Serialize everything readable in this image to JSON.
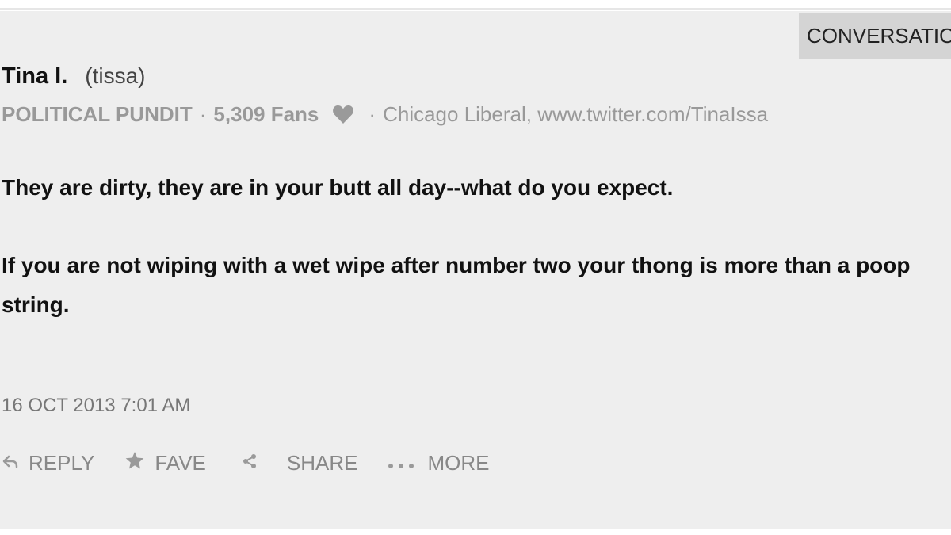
{
  "conversation_tab": {
    "label": "CONVERSATION"
  },
  "author": {
    "name": "Tina I.",
    "handle": "(tissa)"
  },
  "meta": {
    "rank": "POLITICAL PUNDIT",
    "separator": "·",
    "fans": "5,309 Fans",
    "bio": "Chicago Liberal, www.twitter.com/TinaIssa"
  },
  "comment": {
    "paragraphs": [
      "They are dirty, they are in your butt all day--what do you expect.",
      "If you are not wiping with a wet wipe after number two your thong is more than a poop string."
    ]
  },
  "timestamp": "16 OCT 2013 7:01 AM",
  "actions": {
    "reply": "REPLY",
    "fave": "FAVE",
    "share": "SHARE",
    "more": "MORE"
  },
  "colors": {
    "card_background": "#eeeeee",
    "tab_background": "#d4d4d4",
    "muted_text": "#999999",
    "body_text": "#111111"
  },
  "icons": [
    "heart-icon",
    "reply-arrow-icon",
    "star-icon",
    "share-icon",
    "more-dots-icon"
  ]
}
